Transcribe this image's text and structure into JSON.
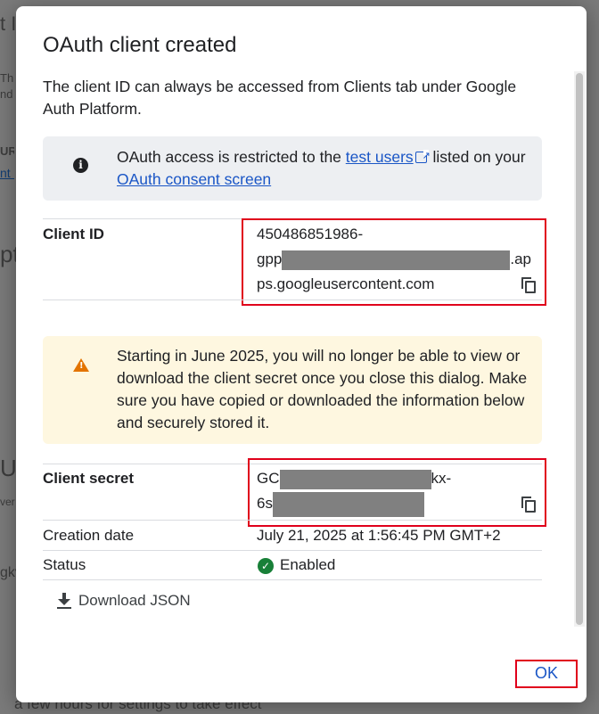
{
  "background": {
    "fragments": [
      "t ID",
      "Th",
      "nd",
      "URI",
      "nt s",
      "pt",
      "U",
      "ver",
      "gkv",
      "a few hours for settings to take effect"
    ]
  },
  "dialog": {
    "title": "OAuth client created",
    "intro": "The client ID can always be accessed from Clients tab under Google Auth Platform.",
    "info": {
      "icon": "info-icon",
      "text_before": "OAuth access is restricted to the ",
      "link1": "test users",
      "text_middle": " listed on your ",
      "link2": "OAuth consent screen"
    },
    "client_id": {
      "label": "Client ID",
      "line1": "450486851986-",
      "line2_prefix": "gpp",
      "line2_suffix": ".ap",
      "line3": "ps.googleusercontent.com"
    },
    "warning": {
      "icon": "warning-icon",
      "text": "Starting in June 2025, you will no longer be able to view or download the client secret once you close this dialog. Make sure you have copied or downloaded the information below and securely stored it."
    },
    "client_secret": {
      "label": "Client secret",
      "line1_prefix": "GC",
      "line1_suffix": "kx-",
      "line2_prefix": "6s"
    },
    "creation_date": {
      "label": "Creation date",
      "value": "July 21, 2025 at 1:56:45 PM GMT+2"
    },
    "status": {
      "label": "Status",
      "value": "Enabled"
    },
    "download_label": "Download JSON",
    "ok_label": "OK"
  },
  "colors": {
    "accent": "#1a56c6",
    "highlight": "#e0001b",
    "warning": "#e37400",
    "success": "#188038"
  }
}
